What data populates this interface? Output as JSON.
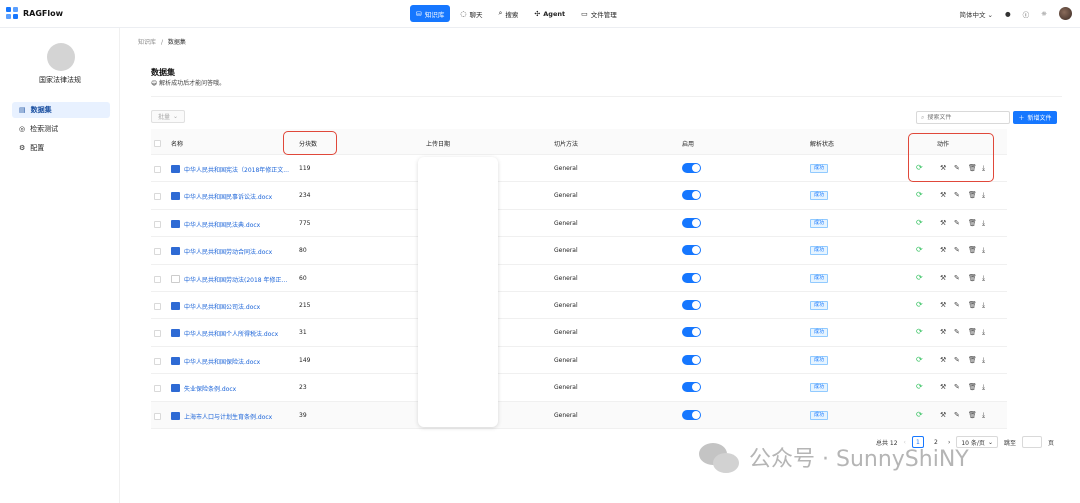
{
  "header": {
    "app_name": "RAGFlow",
    "nav": [
      {
        "label": "知识库",
        "icon": "database-icon",
        "active": true
      },
      {
        "label": "聊天",
        "icon": "chat-icon",
        "active": false
      },
      {
        "label": "搜索",
        "icon": "search-icon",
        "active": false
      },
      {
        "label": "Agent",
        "icon": "agent-icon",
        "active": false
      },
      {
        "label": "文件管理",
        "icon": "folder-icon",
        "active": false
      }
    ],
    "language": "简体中文",
    "accent": "#1677ff"
  },
  "sidebar": {
    "kb_name": "国家法律法规",
    "items": [
      {
        "label": "数据集",
        "active": true
      },
      {
        "label": "检索测试",
        "active": false
      },
      {
        "label": "配置",
        "active": false
      }
    ]
  },
  "breadcrumb": {
    "root": "知识库",
    "sep": "/",
    "current": "数据集"
  },
  "page": {
    "title": "数据集",
    "subtitle": "😄 解析成功后才能问答哦。"
  },
  "toolbar": {
    "batch_label": "批量",
    "search_placeholder": "搜索文件",
    "add_label": "新增文件"
  },
  "table": {
    "columns": [
      "名称",
      "分块数",
      "上传日期",
      "切片方法",
      "启用",
      "解析状态",
      "动作"
    ],
    "rows": [
      {
        "name": "中华人民共和国宪法（2018年修正文...",
        "chunks": "119",
        "method": "General",
        "status": "成功",
        "enabled": true
      },
      {
        "name": "中华人民共和国民事诉讼法.docx",
        "chunks": "234",
        "method": "General",
        "status": "成功",
        "enabled": true
      },
      {
        "name": "中华人民共和国民法典.docx",
        "chunks": "775",
        "method": "General",
        "status": "成功",
        "enabled": true
      },
      {
        "name": "中华人民共和国劳动合同法.docx",
        "chunks": "80",
        "method": "General",
        "status": "成功",
        "enabled": true
      },
      {
        "name": "中华人民共和国劳动法(2018 年修正...",
        "chunks": "60",
        "method": "General",
        "status": "成功",
        "enabled": true
      },
      {
        "name": "中华人民共和国公司法.docx",
        "chunks": "215",
        "method": "General",
        "status": "成功",
        "enabled": true
      },
      {
        "name": "中华人民共和国个人所得税法.docx",
        "chunks": "31",
        "method": "General",
        "status": "成功",
        "enabled": true
      },
      {
        "name": "中华人民共和国保险法.docx",
        "chunks": "149",
        "method": "General",
        "status": "成功",
        "enabled": true
      },
      {
        "name": "失业保险条例.docx",
        "chunks": "23",
        "method": "General",
        "status": "成功",
        "enabled": true
      },
      {
        "name": "上海市人口与计划生育条例.docx",
        "chunks": "39",
        "method": "General",
        "status": "成功",
        "enabled": true
      }
    ]
  },
  "pagination": {
    "total": "总共 12",
    "pages": [
      "1",
      "2"
    ],
    "current": "1",
    "page_size": "10 条/页",
    "jump_label": "跳至",
    "page_suffix": "页"
  },
  "watermark": {
    "text": "公众号 · SunnyShiNY"
  }
}
